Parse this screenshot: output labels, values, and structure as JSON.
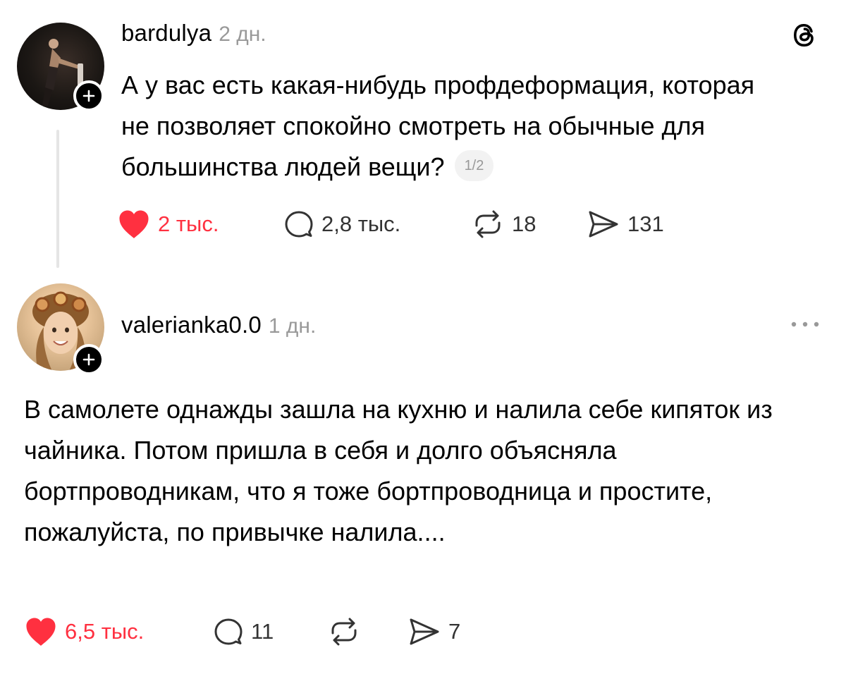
{
  "posts": [
    {
      "username": "bardulya",
      "time": "2 дн.",
      "text": "А у вас есть какая-нибудь профдеформация, которая не позволяет спокойно смотреть на обычные для большинства людей вещи?",
      "page_indicator": "1/2",
      "likes": "2 тыс.",
      "liked": true,
      "replies": "2,8 тыс.",
      "reposts": "18",
      "shares": "131",
      "avatar_icon": "avatar-photo-dark",
      "corner_icon": "threads-logo-icon"
    },
    {
      "username": "valerianka0.0",
      "time": "1 дн.",
      "text": "В самолете однажды зашла на кухню и налила себе кипяток из чайника. Потом пришла в себя и долго объясняла бортпроводникам, что я тоже бортпроводница и простите, пожалуйста, по привычке налила....",
      "likes": "6,5 тыс.",
      "liked": true,
      "replies": "11",
      "reposts": "",
      "shares": "7",
      "avatar_icon": "avatar-photo-girl",
      "corner_icon": "more-options-icon"
    }
  ],
  "colors": {
    "like_red": "#ff3040",
    "muted_gray": "#999999",
    "text": "#000000",
    "thread_line": "#e5e5e5"
  }
}
